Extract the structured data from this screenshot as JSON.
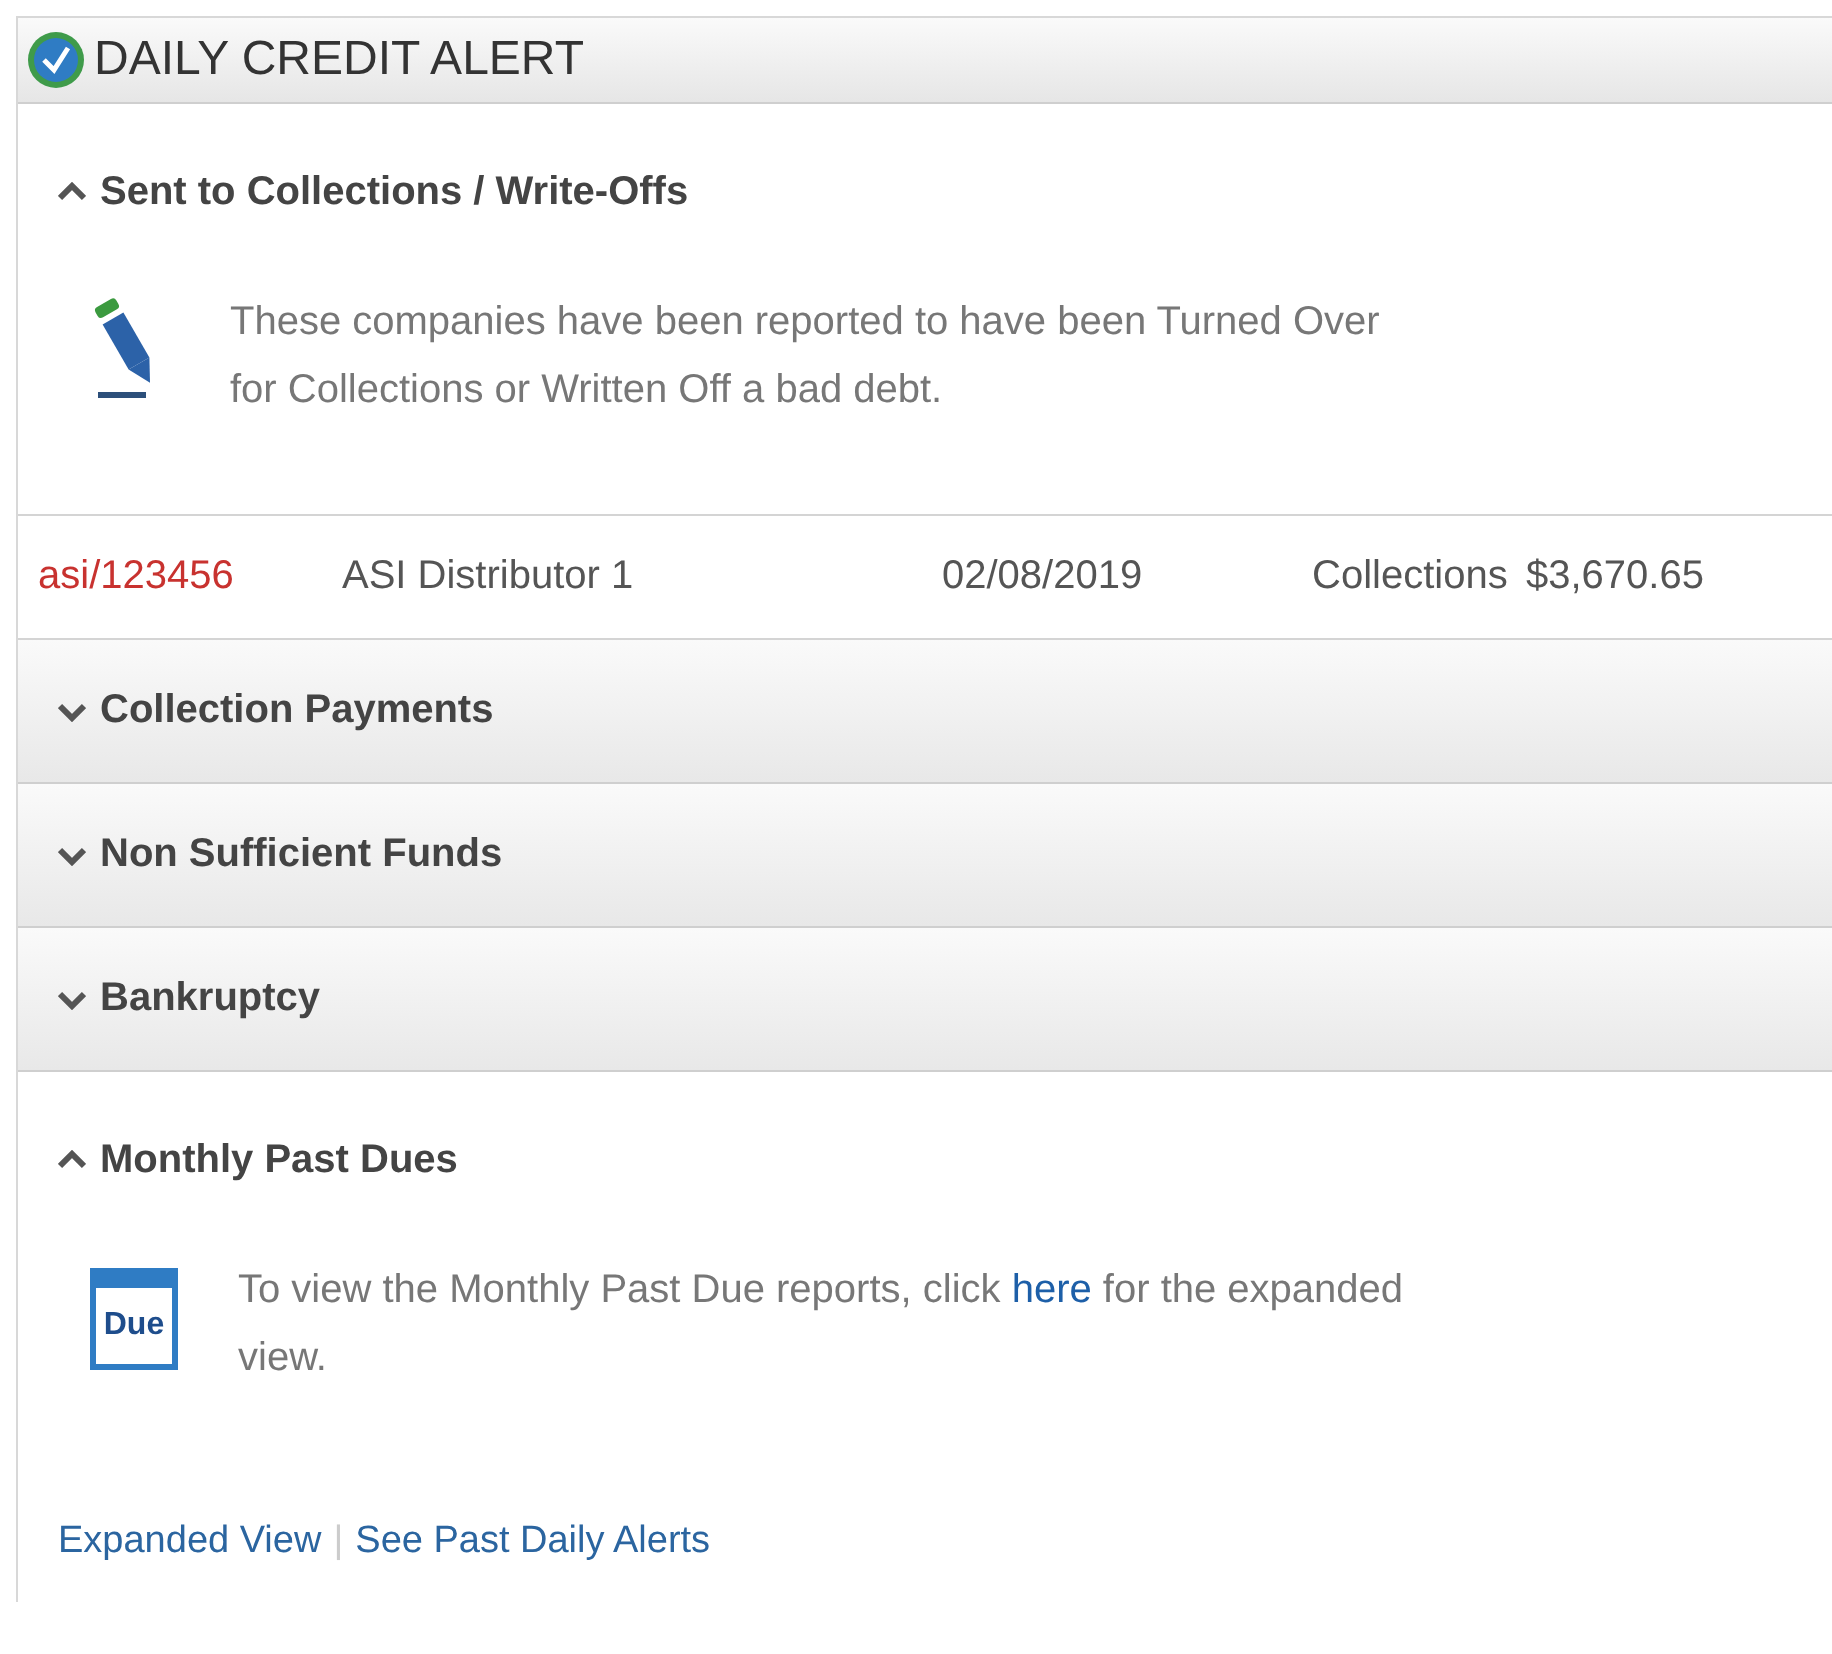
{
  "header": {
    "title": "DAILY CREDIT ALERT"
  },
  "sections": [
    {
      "title": "Sent to Collections / Write-Offs",
      "expanded": true,
      "kind": "collections",
      "text": [
        "These companies have been reported to have been Turned Over for Collections or Written Off a bad debt."
      ],
      "rows": [
        {
          "id": "asi/123456",
          "name": "ASI Distributor 1",
          "date": "02/08/2019",
          "status": "Collections",
          "amount": "$3,670.65"
        }
      ]
    },
    {
      "title": "Collection Payments",
      "expanded": false
    },
    {
      "title": "Non Sufficient Funds",
      "expanded": false
    },
    {
      "title": "Bankruptcy",
      "expanded": false
    },
    {
      "title": "Monthly Past Dues",
      "expanded": true,
      "kind": "past_dues",
      "icon_label": "Due",
      "text": [
        "To view the Monthly Past Due reports, click ",
        "here",
        " for the expanded view."
      ]
    }
  ],
  "footer": {
    "links": [
      "Expanded View",
      "See Past Daily Alerts"
    ],
    "separator": "|"
  }
}
